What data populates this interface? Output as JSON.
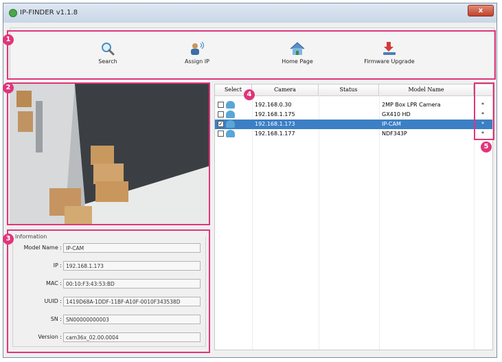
{
  "window": {
    "title": "IP-FINDER v1.1.8",
    "close_label": "x"
  },
  "toolbar": {
    "search_label": "Search",
    "assign_label": "Assign IP",
    "home_label": "Home Page",
    "firmware_label": "Firmware Upgrade"
  },
  "markers": [
    "1",
    "2",
    "3",
    "4",
    "5"
  ],
  "info": {
    "title": "Information",
    "fields": [
      {
        "label": "Model Name :",
        "value": "IP-CAM"
      },
      {
        "label": "IP :",
        "value": "192.168.1.173"
      },
      {
        "label": "MAC :",
        "value": "00:10:F3:43:53:BD"
      },
      {
        "label": "UUID :",
        "value": "1419D68A-1DDF-11BF-A10F-0010F343538D"
      },
      {
        "label": "SN :",
        "value": "SN00000000003"
      },
      {
        "label": "Version :",
        "value": "cam36x_02.00.0004"
      }
    ]
  },
  "table": {
    "headers": [
      "Select",
      "Camera",
      "Status",
      "Model Name",
      ""
    ],
    "rows": [
      {
        "ip": "192.168.0.30",
        "model": "2MP Box LPR Camera",
        "mark": "*",
        "checked": false,
        "selected": false
      },
      {
        "ip": "192.168.1.175",
        "model": "GX410 HD",
        "mark": "*",
        "checked": false,
        "selected": false
      },
      {
        "ip": "192.168.1.173",
        "model": "IP-CAM",
        "mark": "*",
        "checked": true,
        "selected": true
      },
      {
        "ip": "192.168.1.177",
        "model": "NDF343P",
        "mark": "*",
        "checked": false,
        "selected": false
      }
    ]
  },
  "colors": {
    "highlight": "#e0357a",
    "selection": "#3c7fc4"
  }
}
